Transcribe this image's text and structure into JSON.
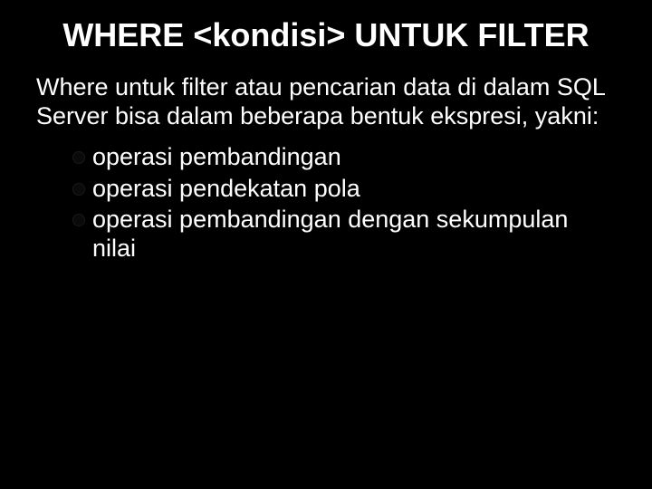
{
  "slide": {
    "title": "WHERE <kondisi> UNTUK FILTER",
    "intro": "Where untuk filter atau pencarian data di dalam SQL Server bisa dalam beberapa bentuk ekspresi, yakni:",
    "bullets": [
      "operasi pembandingan",
      "operasi pendekatan pola",
      "operasi pembandingan dengan sekumpulan nilai"
    ]
  }
}
